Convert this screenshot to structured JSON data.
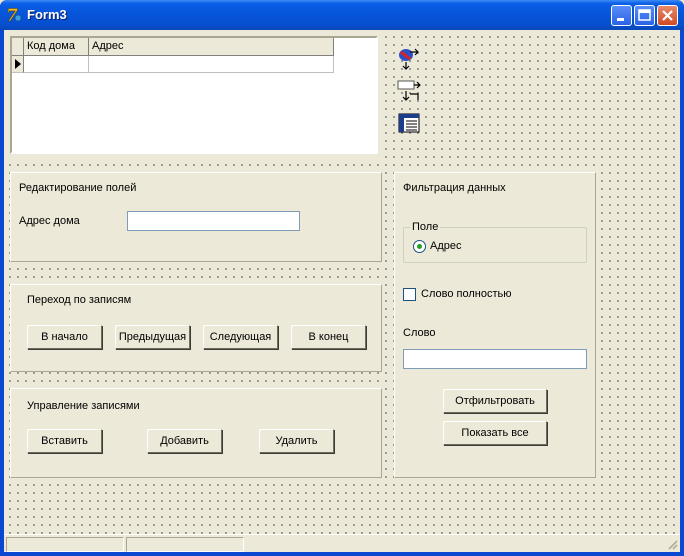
{
  "window": {
    "title": "Form3"
  },
  "grid": {
    "columns": [
      "Код дома",
      "Адрес"
    ]
  },
  "edit_panel": {
    "title": "Редактирование полей",
    "address_label": "Адрес дома",
    "address_value": ""
  },
  "nav_panel": {
    "title": "Переход по записям",
    "first": "В начало",
    "prev": "Предыдущая",
    "next": "Следующая",
    "last": "В конец"
  },
  "records_panel": {
    "title": "Управление записями",
    "insert": "Вставить",
    "add": "Добавить",
    "delete": "Удалить"
  },
  "filter_panel": {
    "title": "Фильтрация данных",
    "field_group": "Поле",
    "field_option": "Адрес",
    "whole_word": "Слово полностью",
    "word_label": "Слово",
    "word_value": "",
    "filter_button": "Отфильтровать",
    "show_all_button": "Показать все"
  }
}
